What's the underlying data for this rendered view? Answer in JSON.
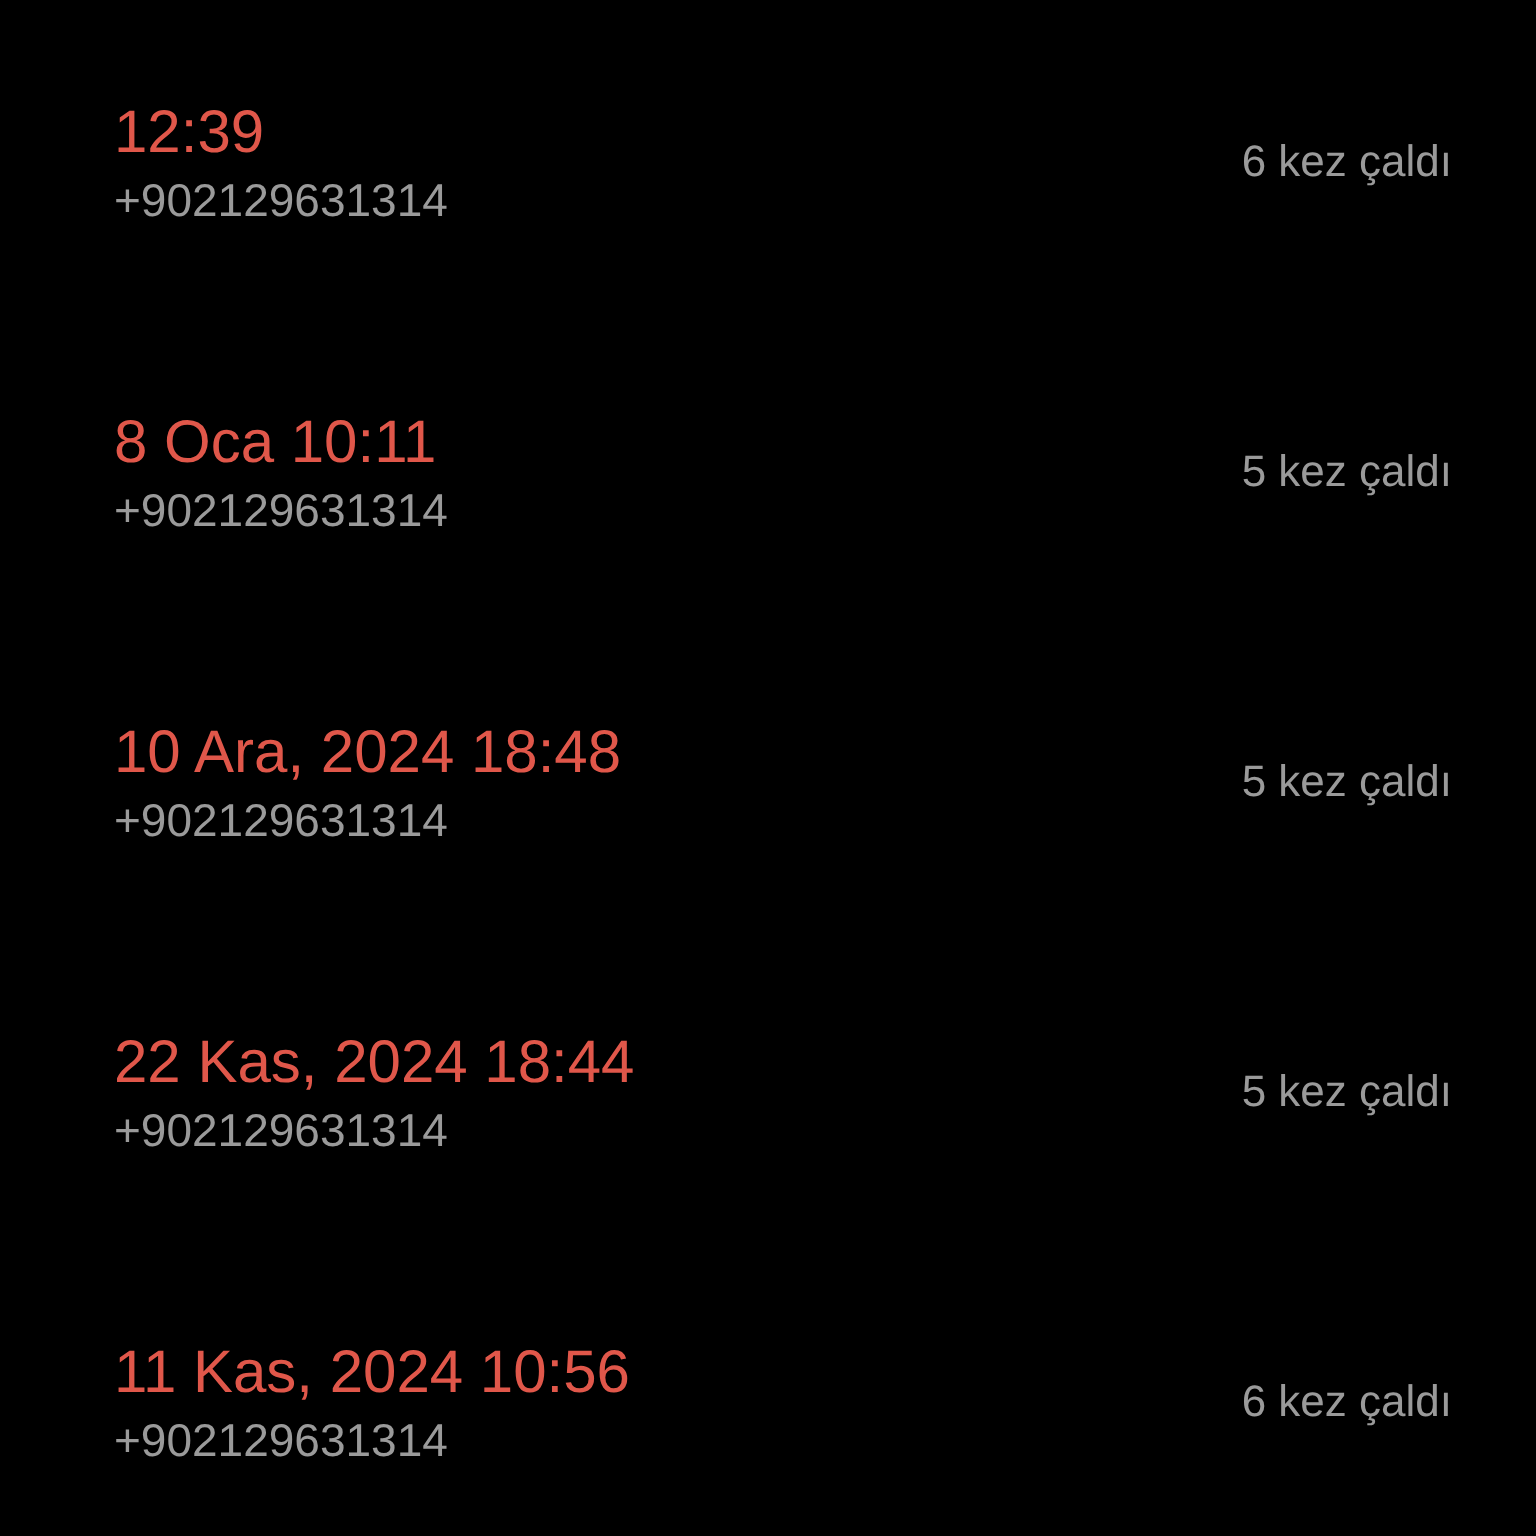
{
  "calls": [
    {
      "time": "12:39",
      "number": "+902129631314",
      "rings": "6 kez çaldı",
      "missed": true
    },
    {
      "time": "8 Oca 10:11",
      "number": "+902129631314",
      "rings": "5 kez çaldı",
      "missed": true
    },
    {
      "time": "10 Ara, 2024 18:48",
      "number": "+902129631314",
      "rings": "5 kez çaldı",
      "missed": true
    },
    {
      "time": "22 Kas, 2024 18:44",
      "number": "+902129631314",
      "rings": "5 kez çaldı",
      "missed": true
    },
    {
      "time": "11 Kas, 2024 10:56",
      "number": "+902129631314",
      "rings": "6 kez çaldı",
      "missed": true
    }
  ]
}
